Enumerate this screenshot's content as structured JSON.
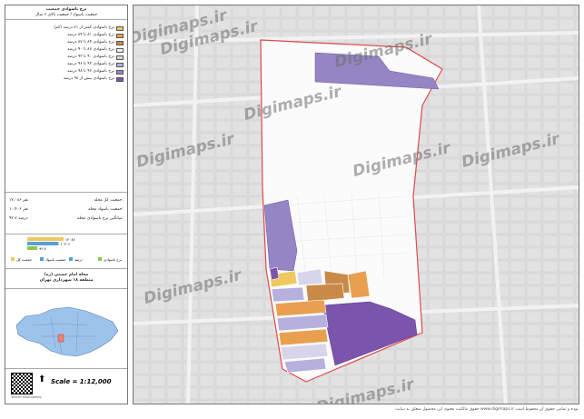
{
  "sidebar": {
    "title_line1": "نرخ باسوادی جمعیت",
    "title_line2": "جمعیت باسواد / جمعیت بالای ۶ سال",
    "legend": [
      {
        "label": "نرخ باسوادی کمتر از ۸۱ درصد (کم)",
        "color": "#f0c860"
      },
      {
        "label": "نرخ باسوادی ۸۱ تا ۸۴ درصد",
        "color": "#e8a050"
      },
      {
        "label": "نرخ باسوادی ۸۴ تا ۸۷ درصد",
        "color": "#c98a48"
      },
      {
        "label": "نرخ باسوادی ۸۷ تا ۹۰ درصد",
        "color": "#f5f5f5"
      },
      {
        "label": "نرخ باسوادی ۹۰ تا ۹۳ درصد",
        "color": "#d8d4ea"
      },
      {
        "label": "نرخ باسوادی ۹۳ تا ۹۶ درصد",
        "color": "#b8b0dc"
      },
      {
        "label": "نرخ باسوادی ۹۶ تا ۹۸ درصد",
        "color": "#9585c4"
      },
      {
        "label": "نرخ باسوادی بیش از ۹۸ درصد",
        "color": "#7a55ab"
      }
    ],
    "stats": [
      {
        "label": "جمعیت کل محله:",
        "value": "۱۲،۰۸۶ نفر"
      },
      {
        "label": "جمعیت باسواد محله:",
        "value": "۱۰،۴۰۶ نفر"
      },
      {
        "label": "میانگین نرخ باسوادی محله:",
        "value": "۹۲.۷ درصد"
      }
    ],
    "bars": [
      {
        "label": "کل",
        "value": 12086,
        "display": "۱۲۰۸۶",
        "color": "#f0c860"
      },
      {
        "label": "باسواد",
        "value": 10406,
        "display": "۱۰۴۰۶",
        "color": "#5aa0d8"
      },
      {
        "label": "درصد",
        "value": 92.7,
        "display": "۹۲.۷",
        "color": "#8cc850"
      }
    ],
    "bar_legend": [
      "جمعیت کل",
      "جمعیت باسواد",
      "درصد",
      "نرخ باسوادی"
    ],
    "neighborhood": "محله امام خمینی (ره)",
    "district": "منطقه ۱۸ شهرداری تهران",
    "scale": "Scale = 1:12,000",
    "credit": "Tehran Municipality"
  },
  "footer": "حقوق مالکیت معنوی این محصول متعلق به سایت www.digimaps.ir بوده و تمامی حقوق آن محفوظ است.",
  "watermarks": [
    "Digimaps.ir",
    "Digimaps.ir",
    "Digimaps.ir",
    "Digimaps.ir",
    "Digimaps.ir",
    "Digimaps.ir",
    "Digimaps.ir",
    "Digimaps.ir",
    "Digimaps.ir"
  ],
  "colors": {
    "boundary": "#e04848",
    "purple": "#7a55ab",
    "lilac": "#9585c4",
    "orange": "#c98a48",
    "map_bg": "#dcdcdc"
  }
}
